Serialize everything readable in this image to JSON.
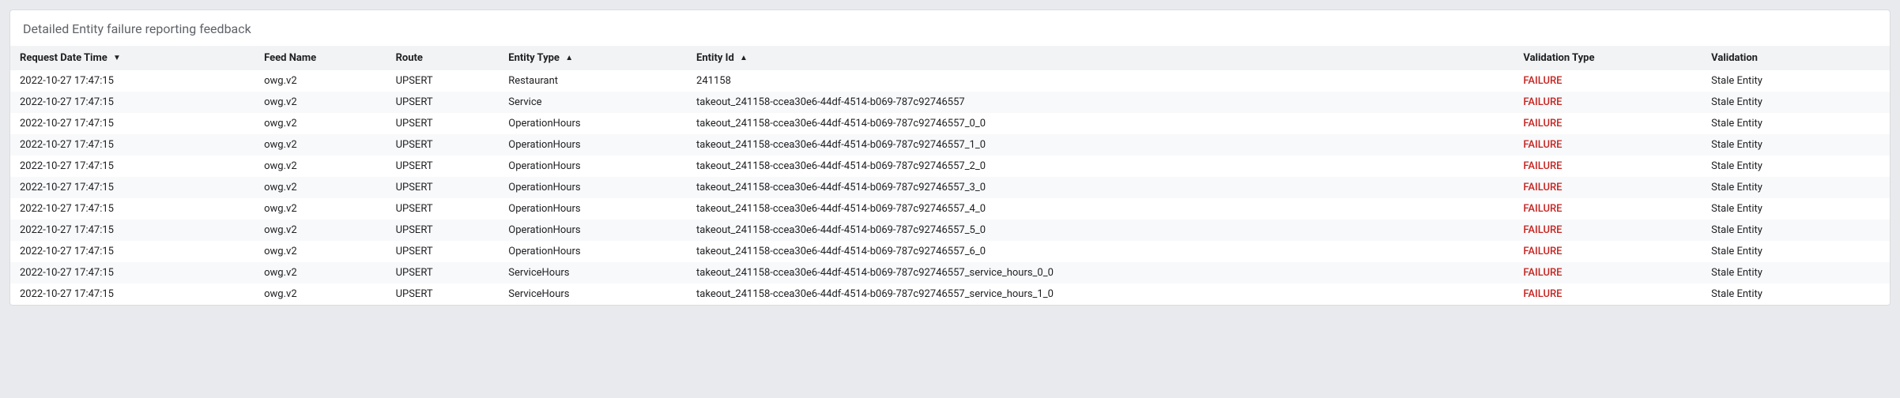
{
  "panel": {
    "title": "Detailed Entity failure reporting feedback"
  },
  "table": {
    "headers": {
      "request_date_time": "Request Date Time",
      "feed_name": "Feed Name",
      "route": "Route",
      "entity_type": "Entity Type",
      "entity_id": "Entity Id",
      "validation_type": "Validation Type",
      "validation": "Validation"
    },
    "sort": {
      "request_date_time": "desc",
      "entity_type": "asc",
      "entity_id": "asc"
    },
    "rows": [
      {
        "request_date_time": "2022-10-27 17:47:15",
        "feed_name": "owg.v2",
        "route": "UPSERT",
        "entity_type": "Restaurant",
        "entity_id": "241158",
        "validation_type": "FAILURE",
        "validation": "Stale Entity"
      },
      {
        "request_date_time": "2022-10-27 17:47:15",
        "feed_name": "owg.v2",
        "route": "UPSERT",
        "entity_type": "Service",
        "entity_id": "takeout_241158-ccea30e6-44df-4514-b069-787c92746557",
        "validation_type": "FAILURE",
        "validation": "Stale Entity"
      },
      {
        "request_date_time": "2022-10-27 17:47:15",
        "feed_name": "owg.v2",
        "route": "UPSERT",
        "entity_type": "OperationHours",
        "entity_id": "takeout_241158-ccea30e6-44df-4514-b069-787c92746557_0_0",
        "validation_type": "FAILURE",
        "validation": "Stale Entity"
      },
      {
        "request_date_time": "2022-10-27 17:47:15",
        "feed_name": "owg.v2",
        "route": "UPSERT",
        "entity_type": "OperationHours",
        "entity_id": "takeout_241158-ccea30e6-44df-4514-b069-787c92746557_1_0",
        "validation_type": "FAILURE",
        "validation": "Stale Entity"
      },
      {
        "request_date_time": "2022-10-27 17:47:15",
        "feed_name": "owg.v2",
        "route": "UPSERT",
        "entity_type": "OperationHours",
        "entity_id": "takeout_241158-ccea30e6-44df-4514-b069-787c92746557_2_0",
        "validation_type": "FAILURE",
        "validation": "Stale Entity"
      },
      {
        "request_date_time": "2022-10-27 17:47:15",
        "feed_name": "owg.v2",
        "route": "UPSERT",
        "entity_type": "OperationHours",
        "entity_id": "takeout_241158-ccea30e6-44df-4514-b069-787c92746557_3_0",
        "validation_type": "FAILURE",
        "validation": "Stale Entity"
      },
      {
        "request_date_time": "2022-10-27 17:47:15",
        "feed_name": "owg.v2",
        "route": "UPSERT",
        "entity_type": "OperationHours",
        "entity_id": "takeout_241158-ccea30e6-44df-4514-b069-787c92746557_4_0",
        "validation_type": "FAILURE",
        "validation": "Stale Entity"
      },
      {
        "request_date_time": "2022-10-27 17:47:15",
        "feed_name": "owg.v2",
        "route": "UPSERT",
        "entity_type": "OperationHours",
        "entity_id": "takeout_241158-ccea30e6-44df-4514-b069-787c92746557_5_0",
        "validation_type": "FAILURE",
        "validation": "Stale Entity"
      },
      {
        "request_date_time": "2022-10-27 17:47:15",
        "feed_name": "owg.v2",
        "route": "UPSERT",
        "entity_type": "OperationHours",
        "entity_id": "takeout_241158-ccea30e6-44df-4514-b069-787c92746557_6_0",
        "validation_type": "FAILURE",
        "validation": "Stale Entity"
      },
      {
        "request_date_time": "2022-10-27 17:47:15",
        "feed_name": "owg.v2",
        "route": "UPSERT",
        "entity_type": "ServiceHours",
        "entity_id": "takeout_241158-ccea30e6-44df-4514-b069-787c92746557_service_hours_0_0",
        "validation_type": "FAILURE",
        "validation": "Stale Entity"
      },
      {
        "request_date_time": "2022-10-27 17:47:15",
        "feed_name": "owg.v2",
        "route": "UPSERT",
        "entity_type": "ServiceHours",
        "entity_id": "takeout_241158-ccea30e6-44df-4514-b069-787c92746557_service_hours_1_0",
        "validation_type": "FAILURE",
        "validation": "Stale Entity"
      }
    ]
  }
}
